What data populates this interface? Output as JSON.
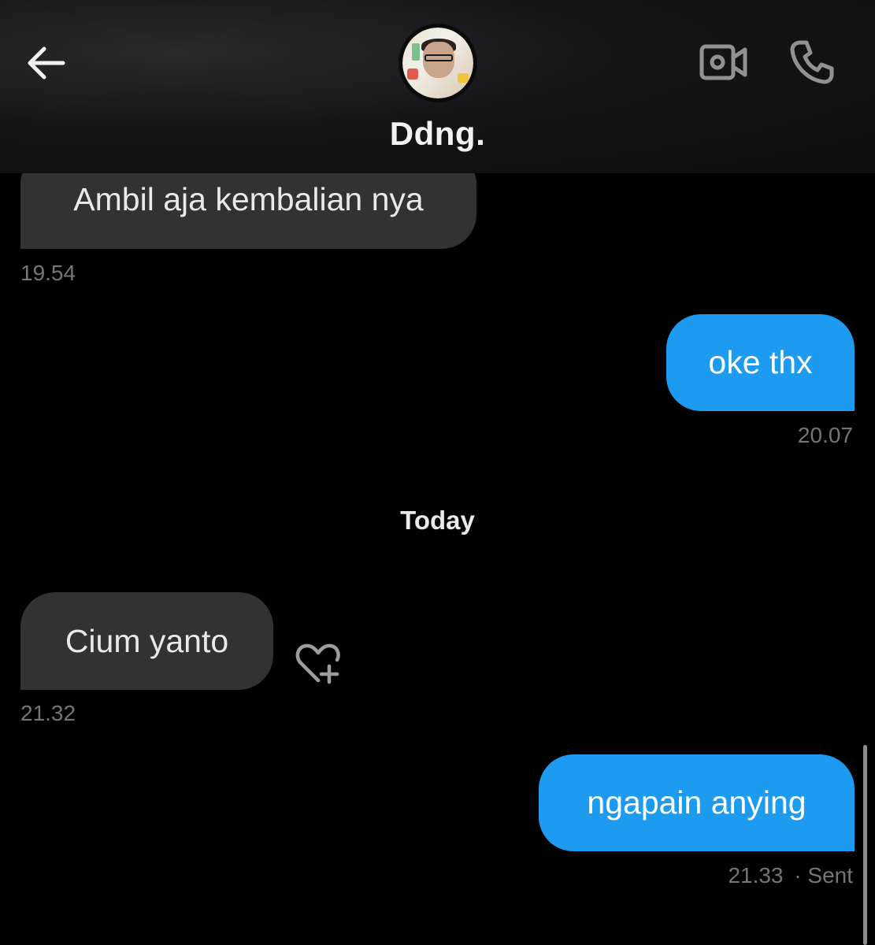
{
  "header": {
    "contact_name": "Ddng.",
    "icons": {
      "back": "back-arrow-icon",
      "video": "video-call-icon",
      "phone": "phone-call-icon"
    }
  },
  "messages": [
    {
      "direction": "in",
      "text": "Ambil aja kembalian nya",
      "time": "19.54"
    },
    {
      "direction": "out",
      "text": "oke thx",
      "time": "20.07"
    },
    {
      "direction": "in",
      "text": "Cium yanto",
      "time": "21.32"
    },
    {
      "direction": "out",
      "text": "ngapain anying",
      "time": "21.33",
      "status": "· Sent"
    }
  ],
  "divider": {
    "label": "Today"
  },
  "reaction_icon": "heart-plus-icon",
  "colors": {
    "background": "#000000",
    "incoming_bubble": "#2f3336",
    "outgoing_bubble": "#1d9bf0",
    "timestamp": "#71767b"
  }
}
